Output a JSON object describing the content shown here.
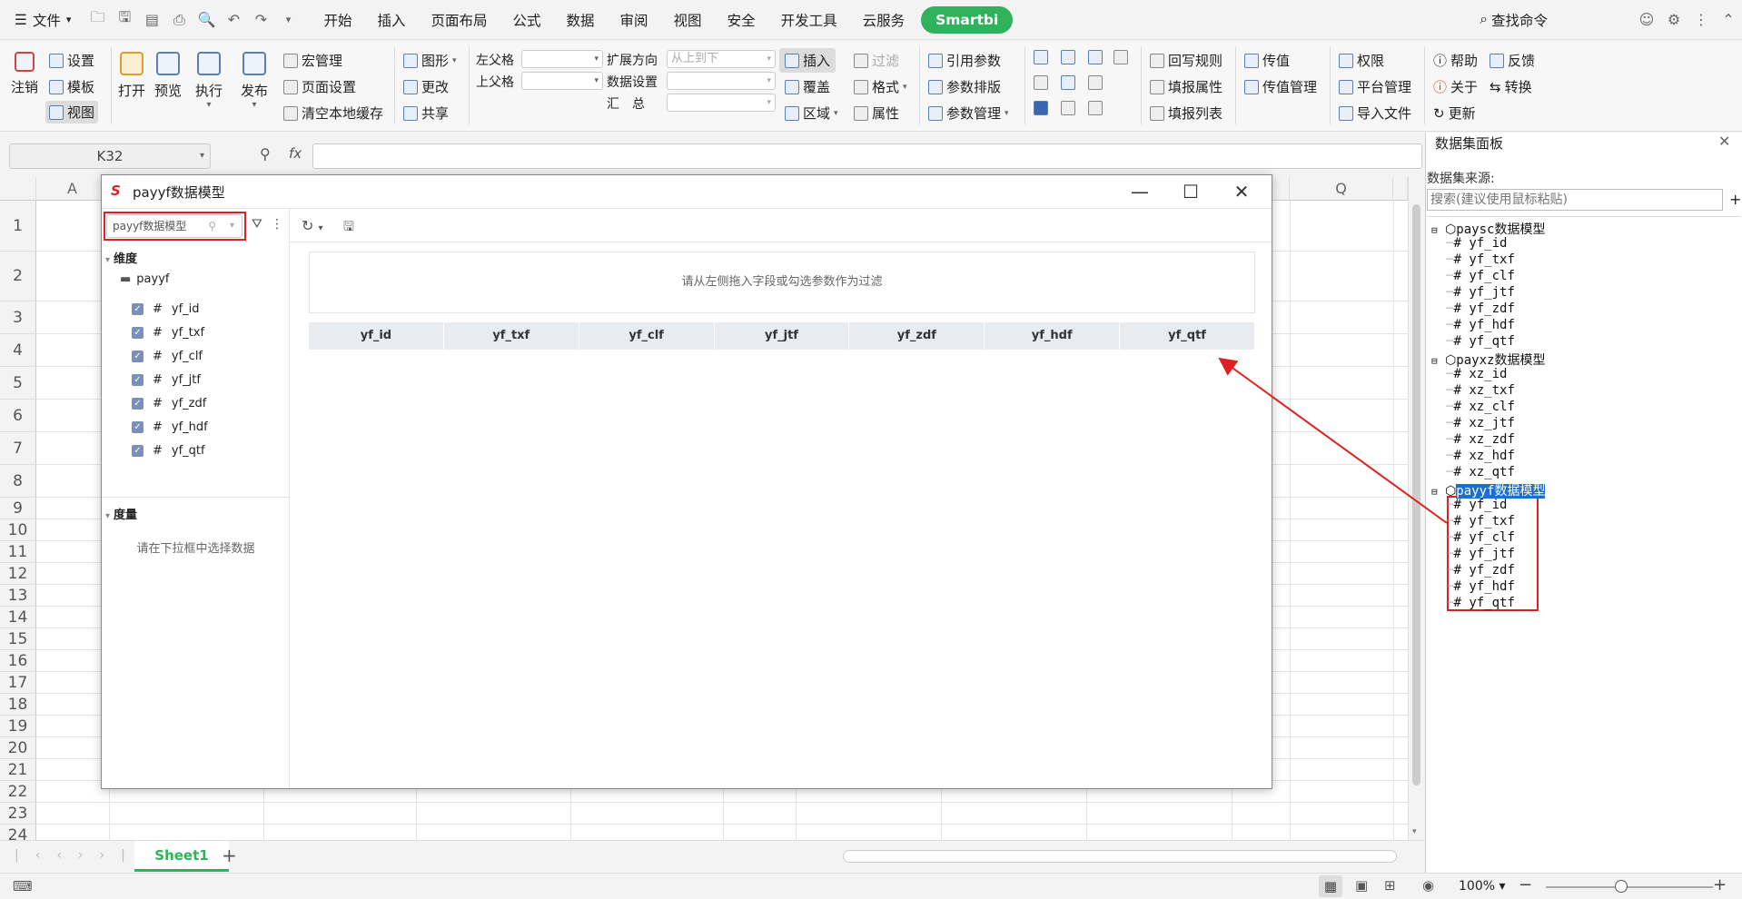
{
  "menubar": {
    "file": "文件",
    "tabs": [
      "开始",
      "插入",
      "页面布局",
      "公式",
      "数据",
      "审阅",
      "视图",
      "安全",
      "开发工具",
      "云服务"
    ],
    "smartbi": "Smartbi",
    "search": "查找命令"
  },
  "ribbon": {
    "logout": "注销",
    "settings": "设置",
    "template": "模板",
    "view": "视图",
    "open": "打开",
    "preview": "预览",
    "execute": "执行",
    "publish": "发布",
    "macro": "宏管理",
    "page_setup": "页面设置",
    "clear_cache": "清空本地缓存",
    "chart": "图形",
    "modify": "更改",
    "share": "共享",
    "left_parent": "左父格",
    "top_parent": "上父格",
    "expand_dir": "扩展方向",
    "expand_dir_value": "从上到下",
    "data_setting": "数据设置",
    "summary": "汇　总",
    "insert": "插入",
    "filter": "过滤",
    "cover": "覆盖",
    "format": "格式",
    "region": "区域",
    "attribute": "属性",
    "ref_param": "引用参数",
    "param_layout": "参数排版",
    "param_manage": "参数管理",
    "writeback_rule": "回写规则",
    "fill_attr": "填报属性",
    "fill_list": "填报列表",
    "pass_value": "传值",
    "pass_value_manage": "传值管理",
    "permission": "权限",
    "platform_manage": "平台管理",
    "import_file": "导入文件",
    "help": "帮助",
    "feedback": "反馈",
    "about": "关于",
    "convert": "转换",
    "update": "更新"
  },
  "formula": {
    "cell_ref": "K32",
    "fx": "fx"
  },
  "grid": {
    "col_a": "A",
    "col_q": "Q",
    "rows": [
      "1",
      "2",
      "3",
      "4",
      "5",
      "6",
      "7",
      "8",
      "9",
      "10",
      "11",
      "12",
      "13",
      "14",
      "15",
      "16",
      "17",
      "18",
      "19",
      "20",
      "21",
      "22",
      "23",
      "24"
    ]
  },
  "sheet": {
    "tab": "Sheet1",
    "add": "+"
  },
  "status": {
    "zoom": "100%"
  },
  "panel": {
    "title": "数据集面板",
    "source_label": "数据集来源:",
    "search_placeholder": "搜索(建议使用鼠标粘贴)",
    "models": [
      {
        "name": "paysc数据模型",
        "fields": [
          "yf_id",
          "yf_txf",
          "yf_clf",
          "yf_jtf",
          "yf_zdf",
          "yf_hdf",
          "yf_qtf"
        ]
      },
      {
        "name": "payxz数据模型",
        "fields": [
          "xz_id",
          "xz_txf",
          "xz_clf",
          "xz_jtf",
          "xz_zdf",
          "xz_hdf",
          "xz_qtf"
        ]
      },
      {
        "name": "payyf数据模型",
        "fields": [
          "yf_id",
          "yf_txf",
          "yf_clf",
          "yf_jtf",
          "yf_zdf",
          "yf_hdf",
          "yf_qtf"
        ]
      }
    ]
  },
  "dialog": {
    "title": "payyf数据模型",
    "model_select": "payyf数据模型",
    "dimension": "维度",
    "folder": "payyf",
    "fields": [
      "yf_id",
      "yf_txf",
      "yf_clf",
      "yf_jtf",
      "yf_zdf",
      "yf_hdf",
      "yf_qtf"
    ],
    "measure": "度量",
    "measure_hint": "请在下拉框中选择数据",
    "filter_hint": "请从左侧拖入字段或勾选参数作为过滤",
    "columns": [
      "yf_id",
      "yf_txf",
      "yf_clf",
      "yf_jtf",
      "yf_zdf",
      "yf_hdf",
      "yf_qtf"
    ]
  },
  "colors": {
    "accent": "#2fb25b",
    "highlight": "#1a6fd1",
    "annotation": "#e02020"
  }
}
